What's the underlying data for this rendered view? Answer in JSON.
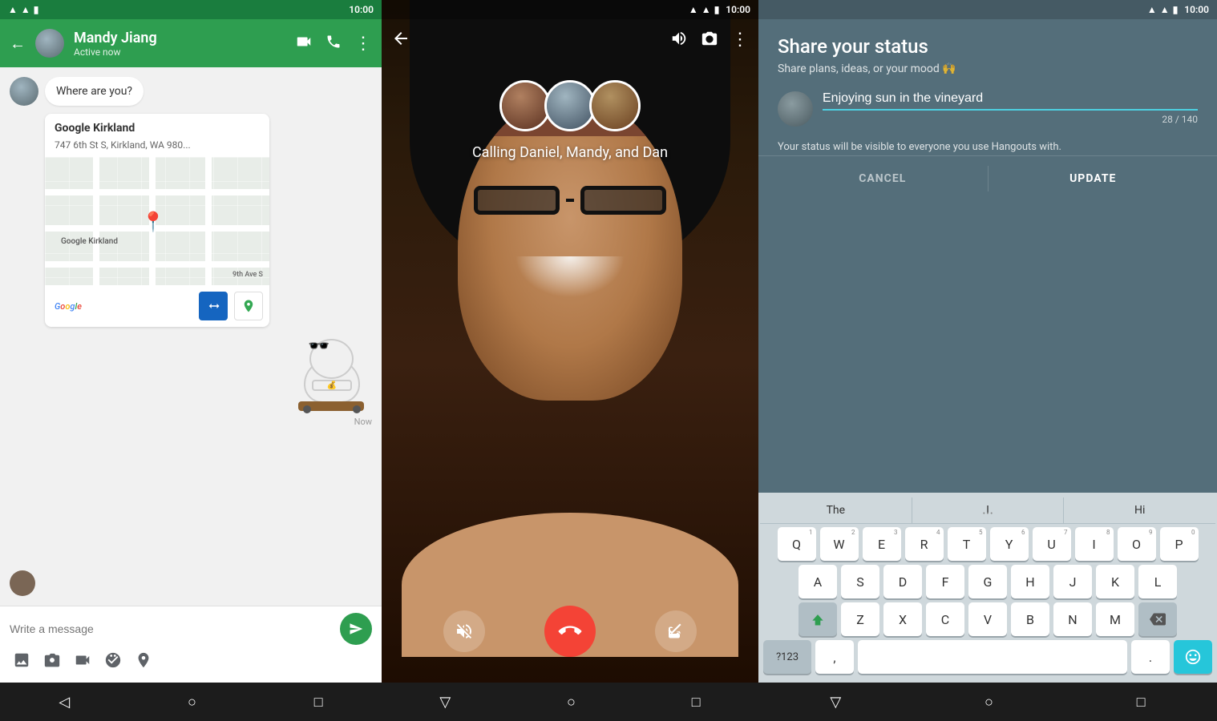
{
  "panel1": {
    "statusBar": {
      "time": "10:00"
    },
    "header": {
      "contactName": "Mandy Jiang",
      "contactStatus": "Active now",
      "backIcon": "←",
      "videoCallIcon": "🎥",
      "phoneIcon": "📞",
      "menuIcon": "⋮"
    },
    "messages": [
      {
        "type": "received",
        "text": "Where are you?",
        "hasAvatar": true
      },
      {
        "type": "received",
        "isMap": true,
        "mapTitle": "Google Kirkland",
        "mapAddress": "747 6th St S, Kirkland, WA 980...",
        "mapLabel": "Google Kirkland"
      },
      {
        "type": "received",
        "isSticker": true,
        "timestamp": "Now"
      }
    ],
    "inputPlaceholder": "Write a message",
    "toolbar": {
      "imageIcon": "🖼",
      "cameraIcon": "📷",
      "videoIcon": "🎥",
      "stickerIcon": "😊",
      "locationIcon": "📍",
      "sendIcon": "▶"
    }
  },
  "panel2": {
    "statusBar": {
      "time": "10:00"
    },
    "callText": "Calling Daniel, Mandy, and Dan",
    "callers": [
      "Daniel",
      "Mandy",
      "Dan"
    ],
    "controls": {
      "muteIcon": "🎤",
      "hangupIcon": "📞",
      "videoOffIcon": "🎥"
    }
  },
  "panel3": {
    "statusBar": {
      "time": "10:00"
    },
    "title": "Share your status",
    "subtitle": "Share plans, ideas, or your mood 🙌",
    "inputValue": "Enjoying sun in the vineyard",
    "charCount": "28 / 140",
    "infoText": "Your status will be visible to everyone you use Hangouts with.",
    "cancelLabel": "CANCEL",
    "updateLabel": "UPDATE",
    "keyboard": {
      "suggestions": [
        "The",
        "I",
        "Hi"
      ],
      "rows": [
        [
          "Q",
          "W",
          "E",
          "R",
          "T",
          "Y",
          "U",
          "I",
          "O",
          "P"
        ],
        [
          "A",
          "S",
          "D",
          "F",
          "G",
          "H",
          "J",
          "K",
          "L"
        ],
        [
          "Z",
          "X",
          "C",
          "V",
          "B",
          "N",
          "M"
        ],
        [
          "?123",
          ",",
          "",
          ".",
          ""
        ]
      ],
      "nums": [
        "1",
        "2",
        "3",
        "4",
        "5",
        "6",
        "7",
        "8",
        "9",
        "0"
      ]
    }
  }
}
